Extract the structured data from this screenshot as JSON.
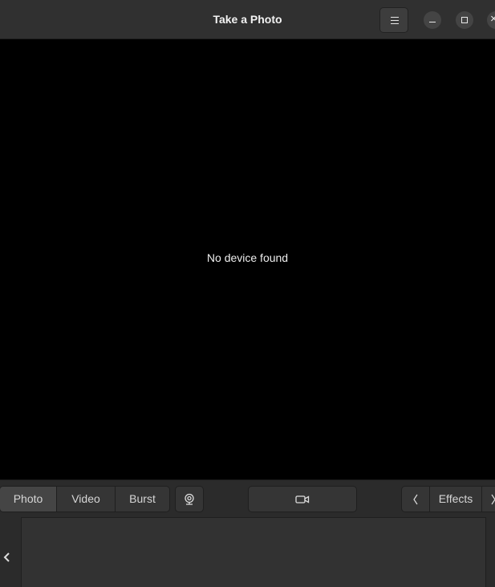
{
  "window": {
    "title": "Take a Photo",
    "menu_icon": "hamburger-menu-icon",
    "controls": [
      "minimize-icon",
      "maximize-icon",
      "close-icon"
    ]
  },
  "viewport": {
    "message": "No device found"
  },
  "toolbar": {
    "modes": [
      {
        "label": "Photo",
        "active": true
      },
      {
        "label": "Video",
        "active": false
      },
      {
        "label": "Burst",
        "active": false
      }
    ],
    "webcam_icon": "webcam-icon",
    "record_icon": "video-camera-icon",
    "effects_label": "Effects",
    "prev_icon": "chevron-left-icon",
    "next_icon": "chevron-right-icon"
  },
  "gallery": {
    "scroll_icon": "chevron-left-icon"
  }
}
